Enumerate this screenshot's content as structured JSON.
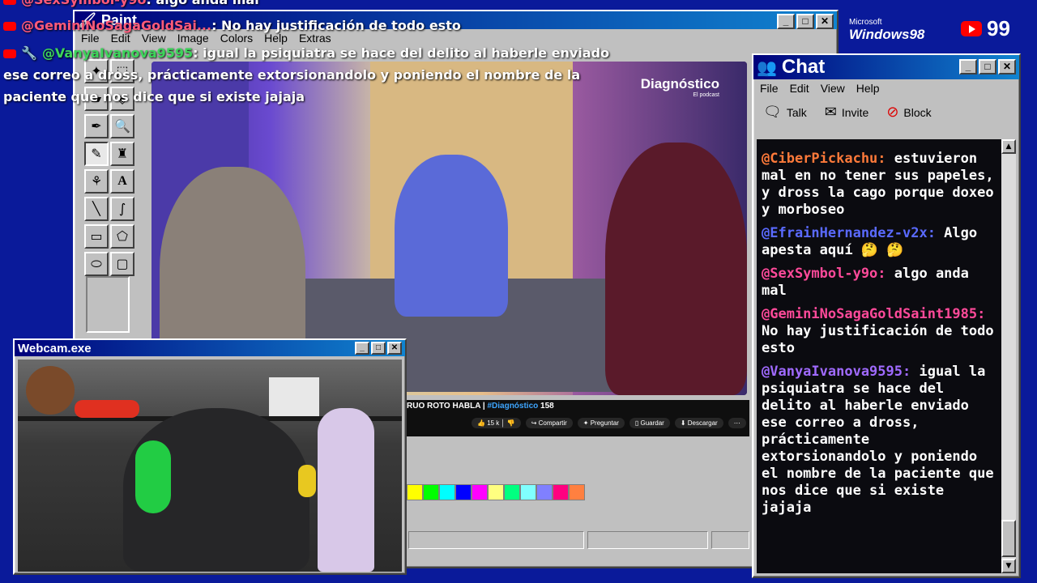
{
  "overlay_chat": [
    {
      "user": "@SexSymbol-y9o",
      "text": ": algo anda mal"
    },
    {
      "user": "@GeminiNoSagaGoldSai...",
      "text": ": No hay justificación de todo esto"
    },
    {
      "user": "@VanyaIvanova9595",
      "text": ": igual la psiquiatra se hace del delito al haberle enviado"
    },
    {
      "text": "ese correo a dross, prácticamente extorsionandolo y poniendo el nombre de la"
    },
    {
      "text": "paciente que nos dice que si existe jajaja"
    }
  ],
  "paint": {
    "title": "Paint",
    "menu": [
      "File",
      "Edit",
      "View",
      "Image",
      "Colors",
      "Help",
      "Extras"
    ],
    "palette": [
      "#ffff00",
      "#00ff00",
      "#00ffff",
      "#0000ff",
      "#ff00ff",
      "#ffff80",
      "#00ff80",
      "#80ffff",
      "#8080ff",
      "#ff0080",
      "#ff8040"
    ]
  },
  "video": {
    "logo": "Diagnóstico",
    "logo_sub": "El podcast",
    "title_prefix": "RUO ROTO HABLA | ",
    "title_tag": "#Diagnóstico",
    "title_suffix": " 158",
    "likes": "15 k",
    "actions": [
      "Compartir",
      "Preguntar",
      "Guardar",
      "Descargar"
    ]
  },
  "branding": {
    "microsoft": "Microsoft",
    "windows": "Windows98",
    "viewer_count": "99"
  },
  "chat": {
    "title": "Chat",
    "menu": [
      "File",
      "Edit",
      "View",
      "Help"
    ],
    "toolbar": [
      "Talk",
      "Invite",
      "Block"
    ],
    "messages": [
      {
        "user": "@CiberPickachu:",
        "text": " estuvieron mal en no tener sus papeles, y dross la cago porque doxeo y morboseo"
      },
      {
        "user": "@EfrainHernandez-v2x:",
        "text": " Algo apesta aquí 🤔 🤔"
      },
      {
        "user": "@SexSymbol-y9o:",
        "text": " algo anda mal"
      },
      {
        "user": "@GeminiNoSagaGoldSaint1985:",
        "text": " No hay justificación de todo esto"
      },
      {
        "user": "@VanyaIvanova9595:",
        "text": " igual la psiquiatra se hace del delito al haberle enviado ese correo a dross, prácticamente extorsionandolo y poniendo el nombre de la paciente que nos dice que si existe jajaja"
      }
    ]
  },
  "webcam": {
    "title": "Webcam.exe"
  },
  "colors": {
    "desktop": "#0a1a9a",
    "title_start": "#00007b",
    "title_end": "#1084d0",
    "chat_bg": "#0b0b10"
  }
}
